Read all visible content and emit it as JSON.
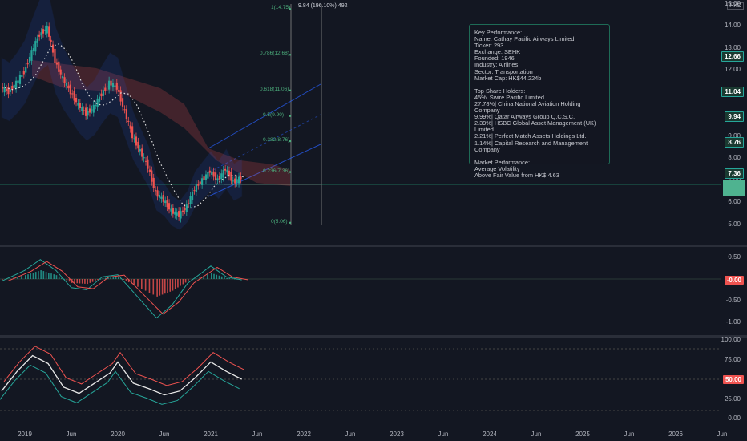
{
  "axis": {
    "currency": "HKD",
    "price_ticks": [
      "15.00",
      "14.00",
      "13.00",
      "12.00",
      "11.00",
      "10.00",
      "9.00",
      "8.00",
      "7.00",
      "6.00",
      "5.00"
    ],
    "macd_ticks": [
      "0.50",
      "0.00",
      "-0.50",
      "-1.00"
    ],
    "rsi_ticks": [
      "100.00",
      "75.00",
      "50.00",
      "25.00",
      "0.00"
    ],
    "time_ticks": [
      "2019",
      "Jun",
      "2020",
      "Jun",
      "2021",
      "Jun",
      "2022",
      "Jun",
      "2023",
      "Jun",
      "2024",
      "Jun",
      "2025",
      "Jun",
      "2026",
      "Jun"
    ]
  },
  "tags": {
    "price_tags": [
      "12.66",
      "11.04",
      "9.94",
      "8.76",
      "7.36"
    ],
    "macd_tag": "-0.00",
    "rsi_tag": "50.00"
  },
  "measure_label": "9.84 (196.10%) 492",
  "fib_levels": [
    "1(14.75)",
    "0.786(12.68)",
    "0.618(11.06)",
    "0.5(9.90)",
    "0.382(8.76)",
    "0.236(7.36)",
    "0(5.06)"
  ],
  "info": {
    "lines_1": [
      "Key Performance:",
      "Name: Cathay Pacific Airways Limited",
      "Ticker: 293",
      "Exchange: SEHK",
      "Founded: 1946",
      "Industry: Airlines",
      "Sector: Transportation",
      "Market Cap: HK$44.224b"
    ],
    "lines_2": [
      "Top Share Holders:",
      "45%| Swire Pacific Limited",
      "27.78%| China National Aviation Holding Company",
      "9.99%| Qatar Airways Group Q.C.S.C.",
      "2.39%| HSBC Global Asset Management (UK) Limited",
      "2.21%| Perfect Match Assets Holdings Ltd.",
      "1.14%| Capital Research and Management Company"
    ],
    "lines_3": [
      "Market Performance:",
      "Average Volatility",
      "Above Fair Value from HK$ 4.63"
    ]
  },
  "colors": {
    "up": "#26a69a",
    "down": "#ef5350",
    "fib": "#4caf7d",
    "box_border": "#1e6b56",
    "band": "#2962ff"
  },
  "chart_data": {
    "type": "candlestick",
    "ylim": [
      4.5,
      15
    ],
    "price_series": [
      {
        "x": "2018-10",
        "close": 11.2
      },
      {
        "x": "2018-11",
        "close": 11.0
      },
      {
        "x": "2018-12",
        "close": 11.4
      },
      {
        "x": "2019-01",
        "close": 11.9
      },
      {
        "x": "2019-02",
        "close": 12.8
      },
      {
        "x": "2019-03",
        "close": 13.6
      },
      {
        "x": "2019-04",
        "close": 13.9
      },
      {
        "x": "2019-05",
        "close": 12.4
      },
      {
        "x": "2019-06",
        "close": 11.6
      },
      {
        "x": "2019-07",
        "close": 11.0
      },
      {
        "x": "2019-08",
        "close": 10.4
      },
      {
        "x": "2019-09",
        "close": 10.0
      },
      {
        "x": "2019-10",
        "close": 10.3
      },
      {
        "x": "2019-11",
        "close": 10.9
      },
      {
        "x": "2019-12",
        "close": 11.4
      },
      {
        "x": "2020-01",
        "close": 11.2
      },
      {
        "x": "2020-02",
        "close": 10.1
      },
      {
        "x": "2020-03",
        "close": 9.0
      },
      {
        "x": "2020-04",
        "close": 8.3
      },
      {
        "x": "2020-05",
        "close": 7.6
      },
      {
        "x": "2020-06",
        "close": 6.4
      },
      {
        "x": "2020-07",
        "close": 6.1
      },
      {
        "x": "2020-08",
        "close": 5.6
      },
      {
        "x": "2020-09",
        "close": 5.4
      },
      {
        "x": "2020-10",
        "close": 5.8
      },
      {
        "x": "2020-11",
        "close": 6.6
      },
      {
        "x": "2020-12",
        "close": 7.0
      },
      {
        "x": "2021-01",
        "close": 7.4
      },
      {
        "x": "2021-02",
        "close": 7.0
      },
      {
        "x": "2021-03",
        "close": 7.5
      },
      {
        "x": "2021-04",
        "close": 6.9
      },
      {
        "x": "2021-05",
        "close": 7.1
      }
    ],
    "macd": [
      {
        "x": "2018-10",
        "v": -0.05
      },
      {
        "x": "2019-01",
        "v": 0.2
      },
      {
        "x": "2019-03",
        "v": 0.45
      },
      {
        "x": "2019-05",
        "v": 0.2
      },
      {
        "x": "2019-07",
        "v": -0.2
      },
      {
        "x": "2019-09",
        "v": -0.25
      },
      {
        "x": "2019-11",
        "v": 0.05
      },
      {
        "x": "2020-01",
        "v": 0.1
      },
      {
        "x": "2020-03",
        "v": -0.3
      },
      {
        "x": "2020-06",
        "v": -0.9
      },
      {
        "x": "2020-08",
        "v": -0.6
      },
      {
        "x": "2020-10",
        "v": -0.1
      },
      {
        "x": "2021-01",
        "v": 0.3
      },
      {
        "x": "2021-03",
        "v": 0.05
      },
      {
        "x": "2021-05",
        "v": -0.02
      }
    ],
    "rsi": [
      {
        "x": "2018-10",
        "v": 35
      },
      {
        "x": "2018-12",
        "v": 60
      },
      {
        "x": "2019-02",
        "v": 80
      },
      {
        "x": "2019-04",
        "v": 70
      },
      {
        "x": "2019-06",
        "v": 40
      },
      {
        "x": "2019-08",
        "v": 32
      },
      {
        "x": "2019-10",
        "v": 45
      },
      {
        "x": "2019-12",
        "v": 58
      },
      {
        "x": "2020-01",
        "v": 72
      },
      {
        "x": "2020-03",
        "v": 45
      },
      {
        "x": "2020-05",
        "v": 38
      },
      {
        "x": "2020-07",
        "v": 30
      },
      {
        "x": "2020-09",
        "v": 35
      },
      {
        "x": "2020-11",
        "v": 52
      },
      {
        "x": "2021-01",
        "v": 72
      },
      {
        "x": "2021-03",
        "v": 60
      },
      {
        "x": "2021-05",
        "v": 50
      }
    ]
  }
}
